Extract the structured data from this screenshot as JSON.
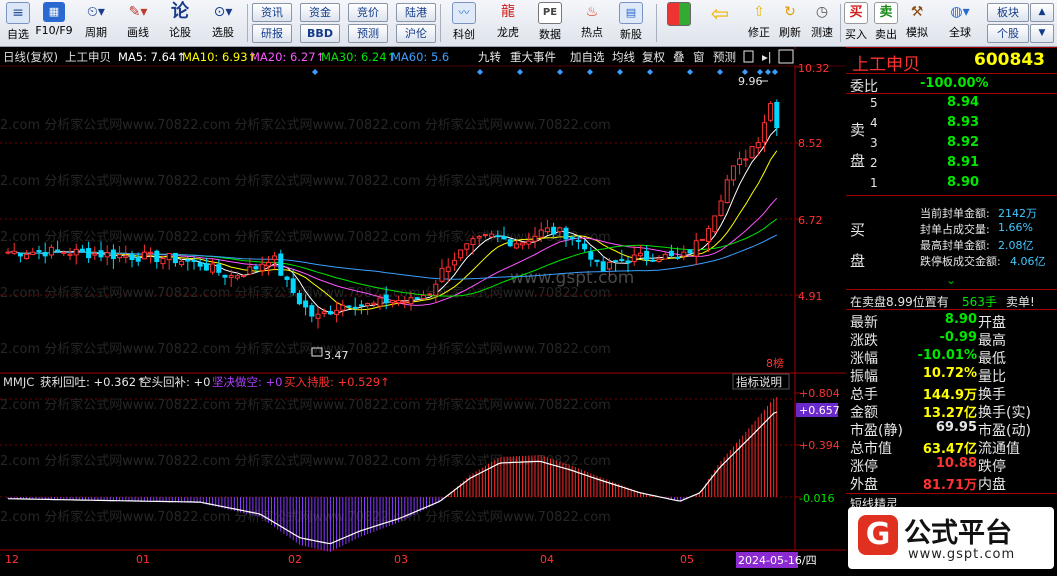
{
  "toolbar": {
    "buttons": [
      {
        "name": "自选",
        "icon": "list-icon"
      },
      {
        "name": "F10/F9",
        "icon": "f10-icon"
      },
      {
        "name": "周期",
        "icon": "clock-icon"
      },
      {
        "name": "画线",
        "icon": "pen-icon"
      },
      {
        "name": "论股",
        "icon": "forum-icon"
      },
      {
        "name": "选股",
        "icon": "magnifier-icon"
      }
    ],
    "small_buttons": [
      "资讯",
      "资金",
      "竞价",
      "陆港",
      "研报",
      "BBD",
      "预测",
      "沪伦"
    ],
    "buttons2": [
      {
        "name": "科创",
        "icon": "chart-icon"
      },
      {
        "name": "龙虎",
        "icon": "dragon-icon"
      },
      {
        "name": "数据",
        "icon": "pe-icon"
      },
      {
        "name": "热点",
        "icon": "fire-icon"
      },
      {
        "name": "新股",
        "icon": "new-stock-icon"
      }
    ],
    "buttons3": [
      {
        "name": "修正",
        "icon": "up-arrow-icon"
      },
      {
        "name": "刷新",
        "icon": "refresh-icon"
      },
      {
        "name": "测速",
        "icon": "speed-icon"
      },
      {
        "name": "买入",
        "label": "买"
      },
      {
        "name": "卖出",
        "label": "卖"
      },
      {
        "name": "模拟",
        "icon": "hammer-icon"
      },
      {
        "name": "全球",
        "icon": "globe-icon"
      }
    ],
    "right_buttons": [
      "板块",
      "个股"
    ]
  },
  "chart_header": {
    "title": "日线(复权)",
    "stock": "上工申贝",
    "ma5": "MA5: 7.64↑",
    "ma10": "MA10: 6.93↑",
    "ma20": "MA20: 6.27↑",
    "ma30": "MA30: 6.24↑",
    "ma60": "MA60: 5.6",
    "tabs": [
      "九转",
      "重大事件",
      "加自选",
      "均线",
      "复权",
      "叠",
      "窗",
      "预测"
    ],
    "colors": {
      "ma5": "#ffffff",
      "ma10": "#ffff00",
      "ma20": "#ff55ff",
      "ma30": "#00e600",
      "ma60": "#3aa0ff"
    }
  },
  "main_chart": {
    "y_ticks": [
      "10.32",
      "8.52",
      "6.72",
      "4.91"
    ],
    "high_label": "9.96",
    "low_label": "3.47",
    "rank_label": "8榜"
  },
  "indicator": {
    "name": "MMJC",
    "v1": "获利回吐: +0.362↑",
    "v2": "空头回补: +0",
    "v3": "坚决做空: +0",
    "v4": "买入持股: +0.529↑",
    "help": "指标说明",
    "y_ticks": [
      "+0.804",
      "+0.394",
      "-0.016"
    ],
    "current": "+0.657"
  },
  "x_axis": {
    "labels": [
      "12",
      "01",
      "02",
      "03",
      "04",
      "05"
    ],
    "date": "2024-05-16/四"
  },
  "panel": {
    "stock_name": "上工申贝",
    "stock_code": "600843",
    "weibi_label": "委比",
    "weibi": "-100.00%",
    "sell_label": "卖盘",
    "buy_label": "买盘",
    "sell_levels": [
      {
        "n": "5",
        "p": "8.94"
      },
      {
        "n": "4",
        "p": "8.93"
      },
      {
        "n": "3",
        "p": "8.92"
      },
      {
        "n": "2",
        "p": "8.91"
      },
      {
        "n": "1",
        "p": "8.90"
      }
    ],
    "seal": [
      {
        "k": "当前封单金额:",
        "v": "2142万"
      },
      {
        "k": "封单占成交量:",
        "v": "1.66%"
      },
      {
        "k": "最高封单金额:",
        "v": "2.08亿"
      },
      {
        "k": "跌停板成交金额:",
        "v": "4.06亿"
      }
    ],
    "onsell": "在卖盘8.99位置有",
    "onsell_qty": "563手",
    "onsell_tail": "卖单!",
    "stats_left": [
      {
        "k": "最新",
        "v": "8.90",
        "c": "green"
      },
      {
        "k": "涨跌",
        "v": "-0.99",
        "c": "green"
      },
      {
        "k": "涨幅",
        "v": "-10.01%",
        "c": "green"
      },
      {
        "k": "振幅",
        "v": "10.72%",
        "c": "yellow"
      },
      {
        "k": "总手",
        "v": "144.9万",
        "c": "yellow"
      },
      {
        "k": "金额",
        "v": "13.27亿",
        "c": "yellow"
      },
      {
        "k": "市盈(静)",
        "v": "69.95",
        "c": "white"
      },
      {
        "k": "总市值",
        "v": "63.47亿",
        "c": "yellow"
      },
      {
        "k": "涨停",
        "v": "10.88",
        "c": "red"
      },
      {
        "k": "外盘",
        "v": "81.71万",
        "c": "red"
      }
    ],
    "stats_right": [
      "开盘",
      "最高",
      "最低",
      "量比",
      "换手",
      "换手(实)",
      "市盈(动)",
      "流通值",
      "跌停",
      "内盘"
    ],
    "bottom_label": "短线精灵"
  },
  "watermark": {
    "text": "2.com 分析家公式网www.70822.com 分析家公式网www.70822.com 分析家公式网www.70822.com",
    "gspt": "www.gspt.com"
  },
  "logo": {
    "big": "公式平台",
    "url": "www.gspt.com"
  }
}
